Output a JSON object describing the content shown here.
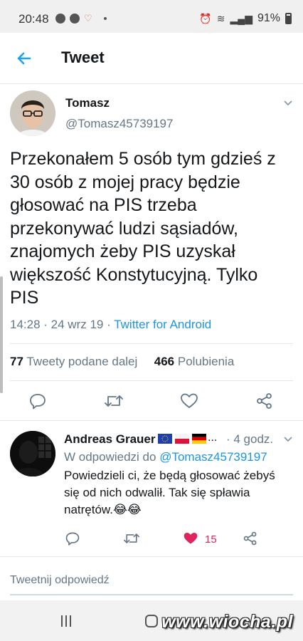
{
  "status_bar": {
    "time": "20:48",
    "battery": "91%",
    "icons": [
      "messenger-icon",
      "messenger-icon",
      "heart-icon",
      "dot-icon",
      "alarm-icon",
      "wifi-icon",
      "wifi-calling-icon",
      "signal-icon",
      "battery-icon"
    ]
  },
  "header": {
    "title": "Tweet",
    "back_icon": "arrow-left-icon"
  },
  "tweet": {
    "author_name": "Tomasz",
    "author_handle": "@Tomasz45739197",
    "text": "Przekonałem 5 osób tym gdzieś z 30 osób z mojej pracy będzie głosować na PIS trzeba przekonywać ludzi sąsiadów, znajomych żeby PIS uzyskał większość Konstytucyjną. Tylko PIS",
    "time": "14:28",
    "date": "24 wrz 19",
    "source": "Twitter for Android",
    "retweets_count": "77",
    "retweets_label": "Tweety podane dalej",
    "likes_count": "466",
    "likes_label": "Polubienia"
  },
  "reply": {
    "author_name": "Andreas Grauer",
    "flags": [
      "eu-flag",
      "poland-flag",
      "germany-flag"
    ],
    "ellipsis": "...",
    "time": "· 4 godz.",
    "reply_to_label": "W odpowiedzi do",
    "reply_to_handle": "@Tomasz45739197",
    "text": "Powiedzieli ci, że będą głosować żebyś się od nich odwalił. Tak się spławia natrętów.😂😂",
    "like_count": "15",
    "liked": true
  },
  "compose": {
    "placeholder": "Tweetnij odpowiedź"
  },
  "watermark": "www.wiocha.pl",
  "colors": {
    "accent": "#1b95e0",
    "like": "#e0245e",
    "secondary_text": "#657786",
    "primary_text": "#14171a",
    "divider": "#e1e8ed"
  }
}
